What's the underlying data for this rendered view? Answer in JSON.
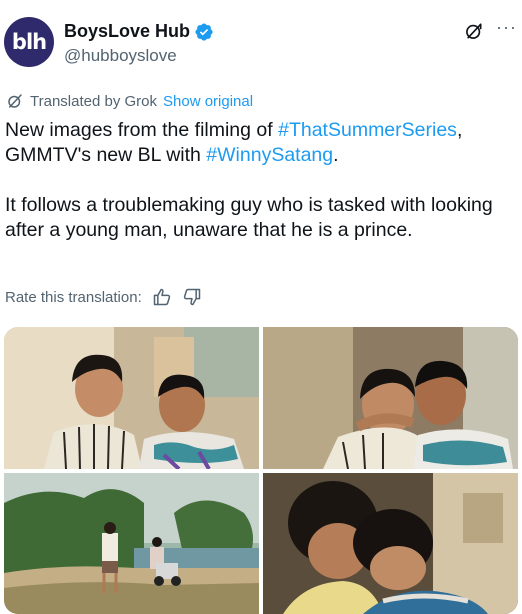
{
  "author": {
    "avatar_text": "blh",
    "display_name": "BoysLove Hub",
    "handle": "@hubboyslove",
    "verified": true
  },
  "translation": {
    "label": "Translated by Grok",
    "show_original": "Show original"
  },
  "tweet": {
    "line1_text1": "New images from the filming of ",
    "line1_hashtag1": "#ThatSummerSeries",
    "line1_text2": ",",
    "line2_text1": "GMMTV's new BL with ",
    "line2_hashtag2": "#WinnySatang",
    "line2_text2": ".",
    "paragraph2": "It follows a troublemaking guy who is tasked with looking after a young man, unaware that he is a prince."
  },
  "rate": {
    "label": "Rate this translation:"
  },
  "icons": {
    "grok": "grok-icon",
    "more": "more-icon",
    "verified": "verified-badge-icon",
    "thumbs_up": "thumbs-up-icon",
    "thumbs_down": "thumbs-down-icon"
  },
  "colors": {
    "accent": "#1d9bf0",
    "secondary_text": "#536471",
    "avatar_bg": "#2e2a6b"
  }
}
